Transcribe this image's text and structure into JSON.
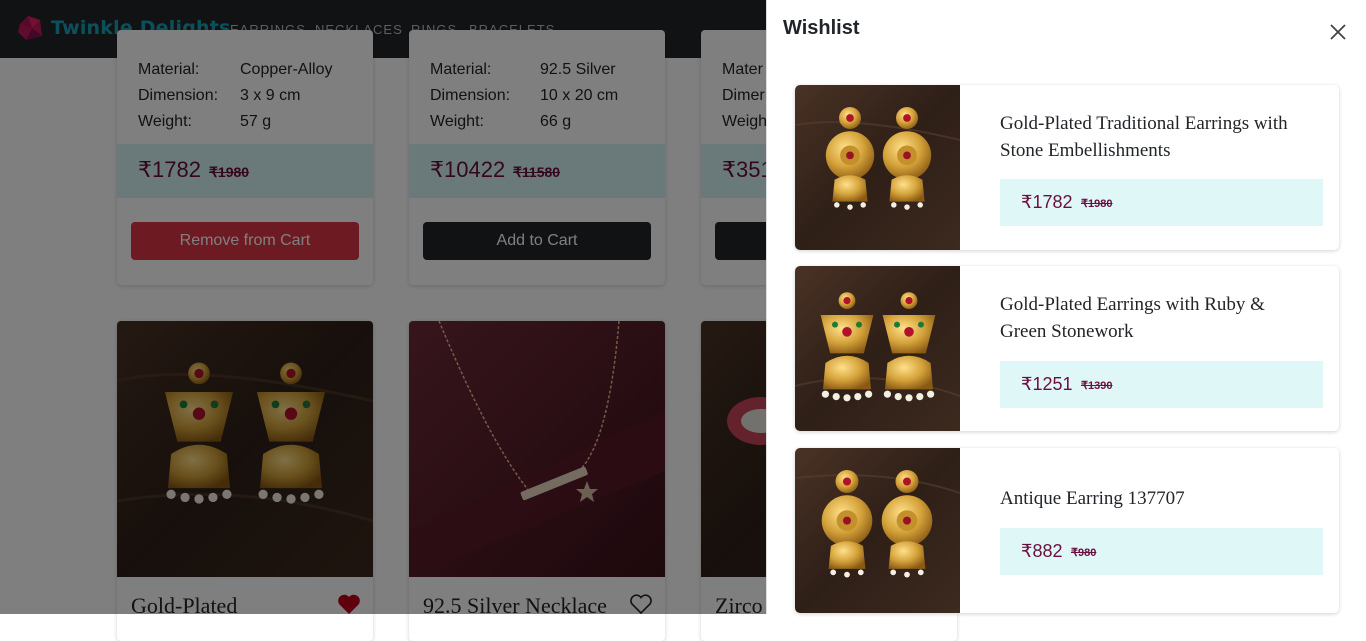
{
  "brand": {
    "name": "Twinkle Delights"
  },
  "nav": {
    "items": [
      "EARRINGS",
      "NECKLACES",
      "RINGS",
      "BRACELETS"
    ]
  },
  "cards": [
    {
      "specs": [
        {
          "label": "Material:",
          "value": "Copper-Alloy"
        },
        {
          "label": "Dimension:",
          "value": "3 x 9  cm"
        },
        {
          "label": "Weight:",
          "value": "57  g"
        }
      ],
      "price": "₹1782",
      "old_price": "₹1980",
      "button": "Remove from Cart"
    },
    {
      "specs": [
        {
          "label": "Material:",
          "value": "92.5 Silver"
        },
        {
          "label": "Dimension:",
          "value": "10 x 20  cm"
        },
        {
          "label": "Weight:",
          "value": "66  g"
        }
      ],
      "price": "₹10422",
      "old_price": "₹11580",
      "button": "Add to Cart"
    },
    {
      "specs": [
        {
          "label": "Mater"
        },
        {
          "label": "Dimer"
        },
        {
          "label": "Weigh"
        }
      ],
      "price": "₹351"
    }
  ],
  "products": [
    {
      "title": "Gold-Plated",
      "wishlisted": true
    },
    {
      "title": "92.5 Silver Necklace",
      "wishlisted": false
    },
    {
      "title": "Zirco",
      "wishlisted": false
    }
  ],
  "wishlist": {
    "title": "Wishlist",
    "items": [
      {
        "title": "Gold-Plated Traditional Earrings with Stone Embellishments",
        "price": "₹1782",
        "old_price": "₹1980"
      },
      {
        "title": "Gold-Plated Earrings with Ruby & Green Stonework",
        "price": "₹1251",
        "old_price": "₹1390"
      },
      {
        "title": "Antique Earring 137707",
        "price": "₹882",
        "old_price": "₹980"
      }
    ]
  },
  "colors": {
    "navbar": "#212529",
    "brand": "#17a2b8",
    "price": "#6b0f3f",
    "price_band": "#d4f3f3",
    "remove_button": "#dc3545",
    "wishlist_heart": "#c0001a"
  }
}
